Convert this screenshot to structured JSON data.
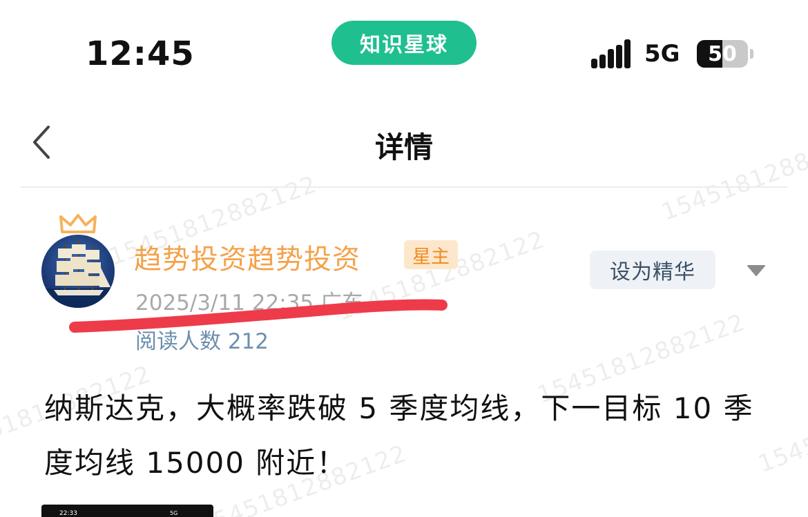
{
  "status_bar": {
    "time": "12:45",
    "app_name": "知识星球",
    "network": "5G",
    "battery": "50",
    "battery_level": 0.5
  },
  "nav": {
    "back_icon": "chevron-left-icon",
    "title": "详情"
  },
  "watermark": "15451812882122",
  "post": {
    "author": "趋势投资趋势投资",
    "owner_badge": "星主",
    "meta": "2025/3/11 22:35  广东",
    "read_count": "阅读人数 212",
    "featured_button": "设为精华",
    "more_icon": "caret-down-icon",
    "content": "纳斯达克，大概率跌破 5 季度均线，下一目标 10 季度均线 15000 附近！",
    "thumbnail": {
      "time": "22:33",
      "status": "5G"
    }
  },
  "colors": {
    "brand_green": "#1fbf8f",
    "author_orange": "#f4a24b",
    "underline_red": "#ee3b4a"
  }
}
